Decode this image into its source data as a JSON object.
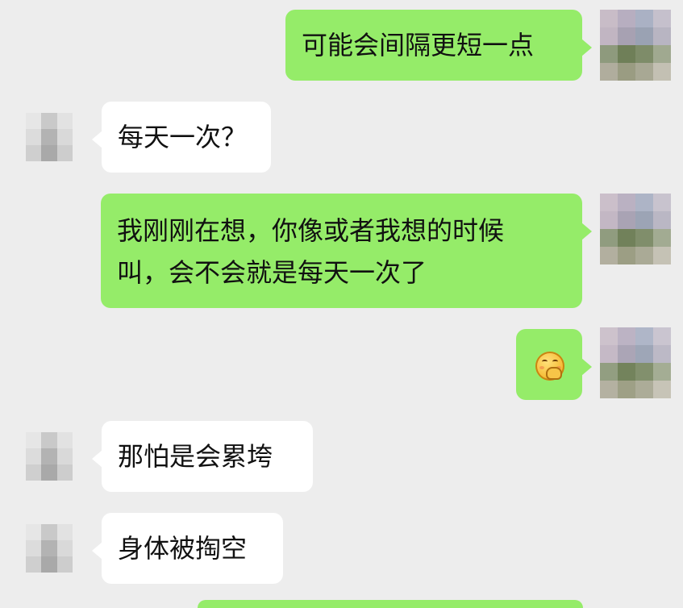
{
  "conversation": {
    "messages": [
      {
        "sender": "me",
        "type": "text",
        "lines": [
          "可能会间隔更短一点"
        ]
      },
      {
        "sender": "other",
        "type": "text",
        "lines": [
          "每天一次？"
        ]
      },
      {
        "sender": "me",
        "type": "text",
        "lines": [
          "我刚刚在想，你像或者我想的时候",
          "叫，会不会就是每天一次了"
        ]
      },
      {
        "sender": "me",
        "type": "emoji",
        "emoji_icon": "shy-giggle-face-icon"
      },
      {
        "sender": "other",
        "type": "text",
        "lines": [
          "那怕是会累垮"
        ]
      },
      {
        "sender": "other",
        "type": "text",
        "lines": [
          "身体被掏空"
        ]
      }
    ]
  },
  "colors": {
    "chat_background": "#ededed",
    "outgoing_bubble": "#95ec69",
    "incoming_bubble": "#ffffff",
    "text": "#111111"
  },
  "avatars": {
    "me_icon": "pixelated-avatar-icon",
    "other_icon": "pixelated-avatar-icon"
  }
}
